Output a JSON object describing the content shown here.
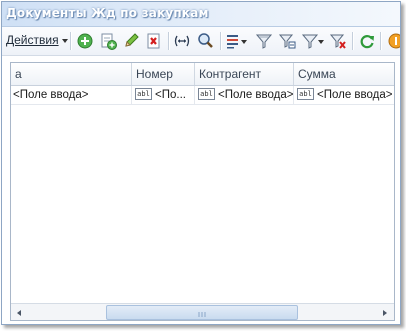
{
  "window": {
    "title": "Документы Жд по закупкам"
  },
  "toolbar": {
    "actions_label": "Действия",
    "buttons": [
      {
        "icon": "add-icon"
      },
      {
        "icon": "copy-icon"
      },
      {
        "icon": "edit-icon"
      },
      {
        "icon": "delete-icon"
      },
      {
        "icon": "interval-icon"
      },
      {
        "icon": "find-icon"
      },
      {
        "icon": "structure-icon"
      },
      {
        "icon": "filter-icon"
      },
      {
        "icon": "filter-by-value-icon"
      },
      {
        "icon": "filter-history-icon"
      },
      {
        "icon": "clear-filter-icon"
      },
      {
        "icon": "refresh-icon"
      },
      {
        "icon": "help-icon"
      }
    ]
  },
  "table": {
    "columns": [
      "а",
      "Номер",
      "Контрагент",
      "Сумма"
    ],
    "rows": [
      {
        "col1": "<Поле ввода>",
        "col2": "<По...",
        "col3": "<Поле ввода>",
        "col4": "<Поле ввода>",
        "field_icon_text": "abl"
      }
    ]
  },
  "colors": {
    "title_gradient_start": "#cfe0f5",
    "title_text": "#ffffff",
    "grid_border": "#a9b7c9"
  }
}
